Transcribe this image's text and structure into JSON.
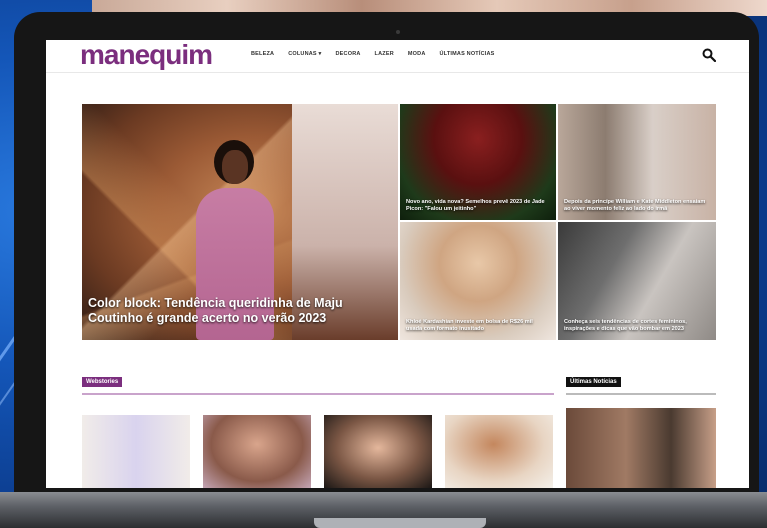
{
  "site": {
    "logo": "manequim",
    "nav": [
      "BELEZA",
      "COLUNAS ▾",
      "DECORA",
      "LAZER",
      "MODA",
      "ÚLTIMAS NOTÍCIAS"
    ]
  },
  "featured": {
    "main_caption": "Color block: Tendência queridinha de Maju Coutinho é grande acerto no verão 2023",
    "small": [
      "Novo ano, vida nova? Semelhos prevê 2023 de Jade Picon: \"Falou um jeitinho\"",
      "Depois da princípe William e Kate Middleton ensaiam ao viver momento feliz ao lado do irmã",
      "Khloé Kardashian investe em bolsa de R$26 mil usada com formato inusitado",
      "Conheça seis tendências de cortes femininos, inspirações e dicas que vão bombar em 2023"
    ]
  },
  "sections": {
    "webstories_label": "Webstories",
    "ultimas_label": "Últimas Notícias"
  },
  "colors": {
    "brand": "#7b2e7e",
    "background": "#0d47a0"
  },
  "icons": {
    "search": "search-icon"
  }
}
